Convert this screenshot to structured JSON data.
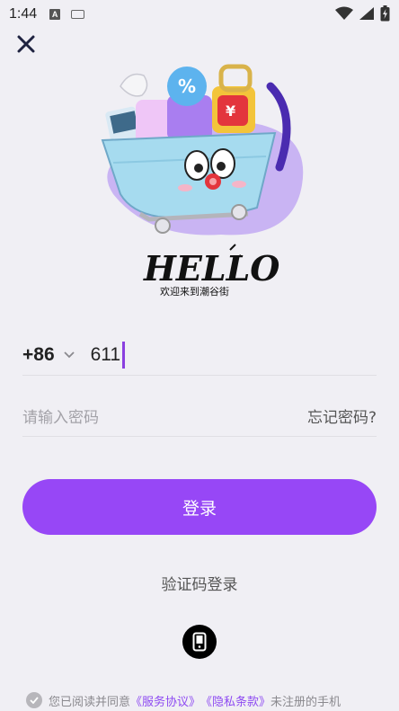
{
  "status_bar": {
    "time": "1:44"
  },
  "close_button": {
    "icon": "close-icon"
  },
  "hero": {
    "logo_text": "HELLO",
    "welcome_text": "欢迎来到潮谷街"
  },
  "phone": {
    "country_code": "+86",
    "value": "611"
  },
  "password": {
    "placeholder": "请输入密码",
    "forgot_label": "忘记密码?"
  },
  "login_button_label": "登录",
  "sms_login_label": "验证码登录",
  "phone_login_icon": "mobile-phone-icon",
  "agreement": {
    "prefix": "您已阅读并同意",
    "service_link": "《服务协议》",
    "privacy_link": "《隐私条款》",
    "suffix": "未注册的手机"
  },
  "colors": {
    "accent": "#9747f6",
    "link": "#8e4bf2",
    "background": "#f0eff4"
  }
}
